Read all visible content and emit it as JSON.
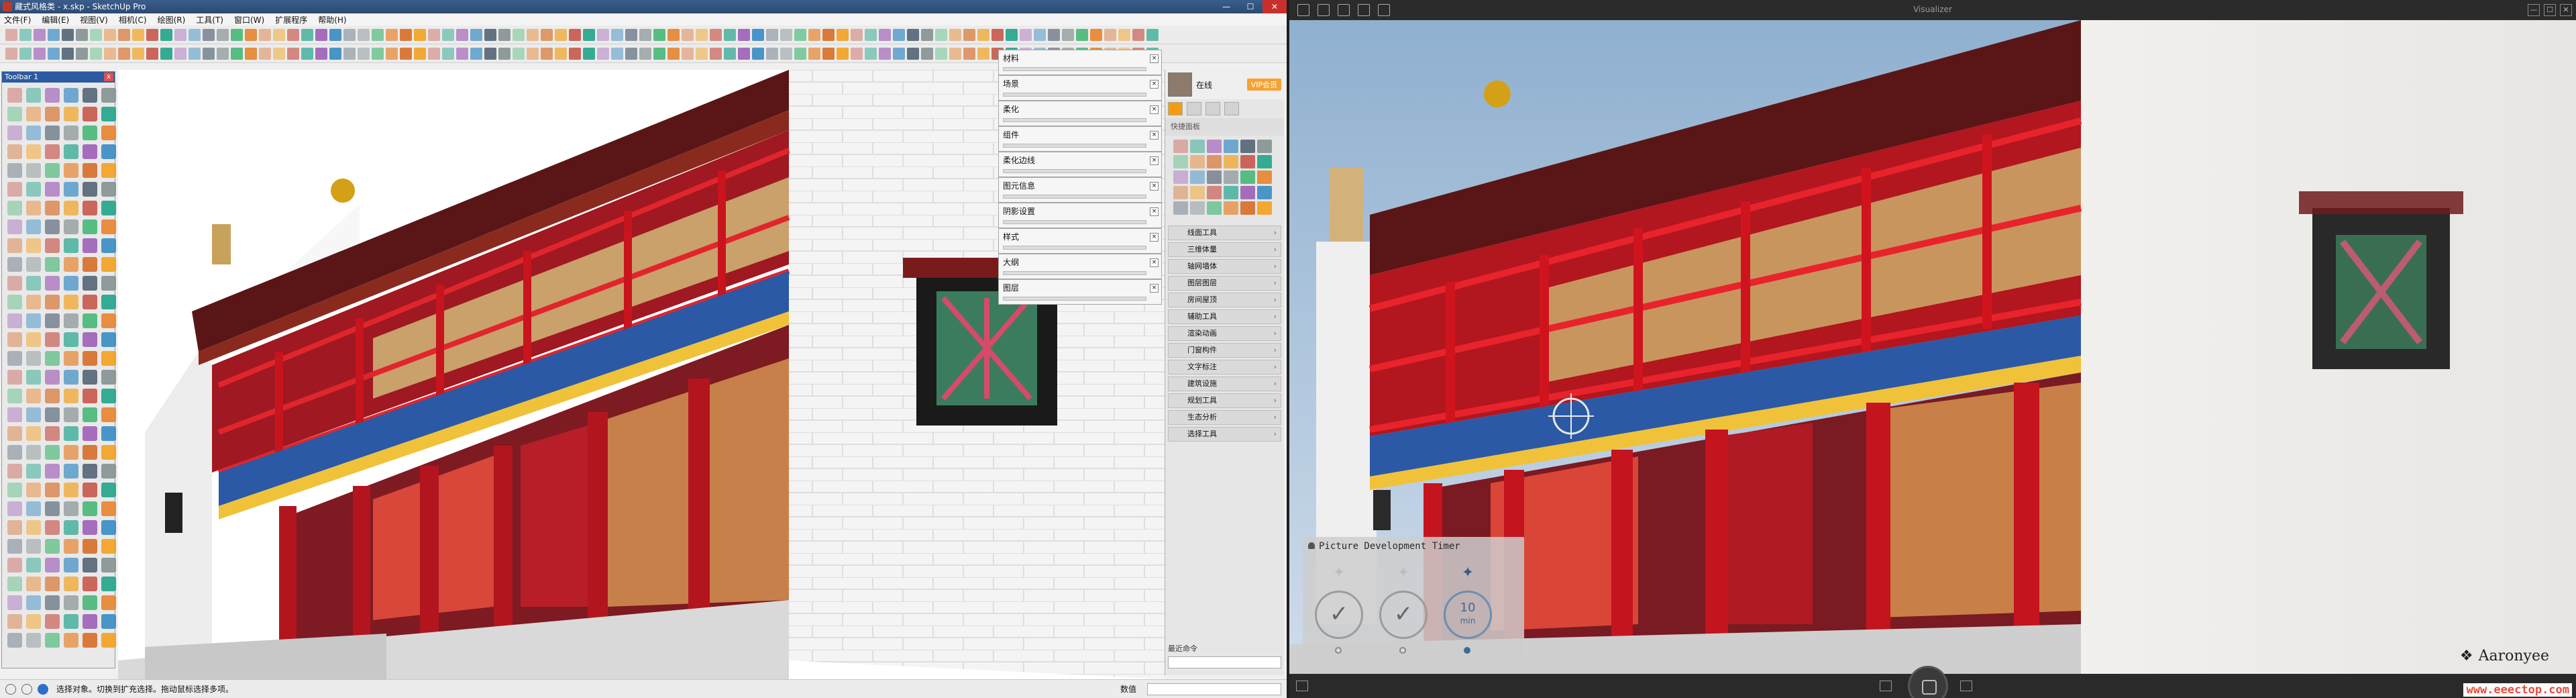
{
  "sketchup": {
    "title": "藏式风格类 - x.skp - SketchUp Pro",
    "window_buttons": [
      "—",
      "☐",
      "✕"
    ],
    "menu": [
      "文件(F)",
      "编辑(E)",
      "视图(V)",
      "相机(C)",
      "绘图(R)",
      "工具(T)",
      "窗口(W)",
      "扩展程序",
      "帮助(H)"
    ],
    "toolbar_panel_title": "Toolbar 1",
    "toolbar_panel_close": "x",
    "tray": [
      {
        "label": "材料"
      },
      {
        "label": "场景"
      },
      {
        "label": "柔化"
      },
      {
        "label": "组件"
      },
      {
        "label": "柔化边线"
      },
      {
        "label": "图元信息"
      },
      {
        "label": "阴影设置"
      },
      {
        "label": "样式"
      },
      {
        "label": "大纲"
      },
      {
        "label": "图层"
      }
    ],
    "tray_pin": "×",
    "plugin": {
      "user_name": "在线",
      "vip_label": "VIP会员",
      "quick_label": "快捷面板",
      "list": [
        "线面工具",
        "三维体量",
        "轴网墙体",
        "图层图层",
        "房间屋顶",
        "辅助工具",
        "渲染动画",
        "门窗构件",
        "文字标注",
        "建筑设施",
        "规划工具",
        "生态分析",
        "选择工具"
      ],
      "footer_label": "最近命令"
    },
    "status": {
      "message": "选择对象。切换到扩充选择。拖动鼠标选择多项。",
      "vcb_label": "数值"
    }
  },
  "render": {
    "window_title": "Visualizer",
    "window_buttons": [
      "—",
      "☐",
      "✕"
    ],
    "timer_panel": {
      "title": "Picture Development Timer",
      "timers": [
        {
          "state": "done",
          "glyph": "✓",
          "spark": "✦"
        },
        {
          "state": "done",
          "glyph": "✓",
          "spark": "✦"
        },
        {
          "state": "active",
          "glyph": "10",
          "sub": "min",
          "spark": "✦"
        }
      ]
    },
    "brand": "Aaronyee",
    "watermark": "www.eeectop.com"
  },
  "colors": {
    "temple_red": "#b3151f",
    "maroon": "#6e1a1a",
    "gold": "#d4a017",
    "sky": "#a9c1d9"
  }
}
